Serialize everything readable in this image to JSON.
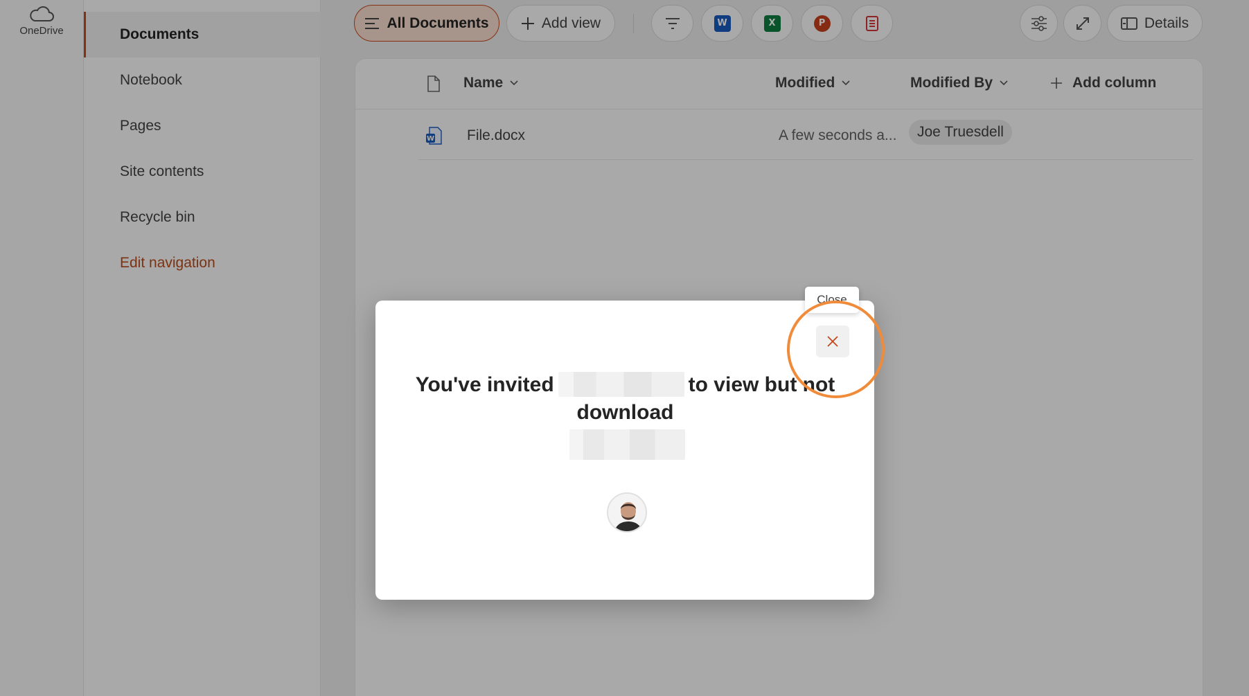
{
  "app_rail": {
    "brand_label": "OneDrive",
    "brand_icon": "cloud-icon"
  },
  "site_nav": {
    "items": [
      {
        "label": "Documents",
        "selected": true
      },
      {
        "label": "Notebook"
      },
      {
        "label": "Pages"
      },
      {
        "label": "Site contents"
      },
      {
        "label": "Recycle bin"
      }
    ],
    "edit_label": "Edit navigation"
  },
  "command_bar": {
    "view_label": "All Documents",
    "add_view_label": "Add view",
    "quick_create": [
      {
        "icon": "word-icon",
        "letter": "W",
        "color": "#185abd"
      },
      {
        "icon": "excel-icon",
        "letter": "X",
        "color": "#107c41"
      },
      {
        "icon": "powerpoint-icon",
        "letter": "P",
        "color": "#c43e1c"
      },
      {
        "icon": "forms-icon",
        "letter": "",
        "color": "#d13438"
      }
    ],
    "details_label": "Details"
  },
  "list": {
    "columns": {
      "name": "Name",
      "modified": "Modified",
      "modified_by": "Modified By",
      "add_column": "Add column"
    },
    "rows": [
      {
        "name": "File.docx",
        "modified": "A few seconds a...",
        "modified_by": "Joe Truesdell"
      }
    ]
  },
  "dialog": {
    "title_prefix": "You've invited",
    "title_suffix": "to view but not download",
    "close_tooltip": "Close"
  },
  "colors": {
    "accent": "#c4471c",
    "highlight_ring": "#f08b3a",
    "selected_view_bg": "#f6dccd"
  }
}
